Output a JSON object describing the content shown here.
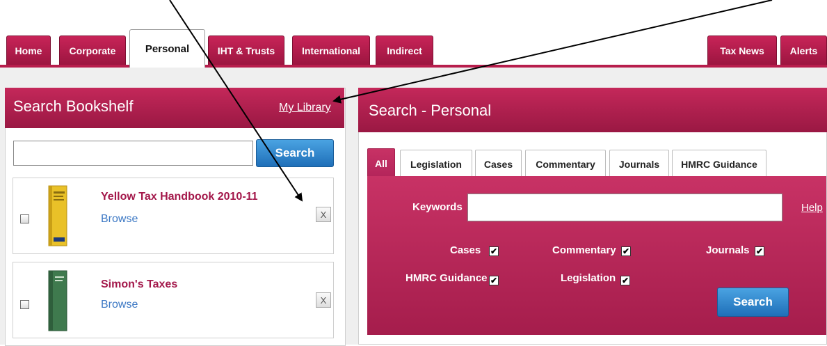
{
  "tabs_left": [
    {
      "label": "Home"
    },
    {
      "label": "Corporate"
    },
    {
      "label": "Personal",
      "active": true
    },
    {
      "label": "IHT & Trusts"
    },
    {
      "label": "International"
    },
    {
      "label": "Indirect"
    }
  ],
  "tabs_right": [
    {
      "label": "Tax News"
    },
    {
      "label": "Alerts"
    }
  ],
  "bookshelf": {
    "title": "Search Bookshelf",
    "my_library_link": "My Library",
    "search_input_value": "",
    "search_button": "Search",
    "books": [
      {
        "title": "Yellow Tax Handbook 2010-11",
        "browse_label": "Browse",
        "remove_label": "X",
        "checked": false,
        "cover_color": "#e9c128"
      },
      {
        "title": "Simon's Taxes",
        "browse_label": "Browse",
        "remove_label": "X",
        "checked": false,
        "cover_color": "#3f7a4e"
      }
    ]
  },
  "search_panel": {
    "title": "Search - Personal",
    "tabs": [
      "All",
      "Legislation",
      "Cases",
      "Commentary",
      "Journals",
      "HMRC Guidance"
    ],
    "active_tab": "All",
    "keywords_label": "Keywords",
    "keywords_value": "",
    "help_link": "Help",
    "filters": [
      {
        "label": "Cases",
        "checked": true
      },
      {
        "label": "Commentary",
        "checked": true
      },
      {
        "label": "Journals",
        "checked": true
      },
      {
        "label": "HMRC Guidance",
        "checked": true
      },
      {
        "label": "Legislation",
        "checked": true
      }
    ],
    "search_button": "Search"
  },
  "colors": {
    "brand": "#b71d4c",
    "button_blue": "#1f6fb8",
    "link_blue": "#3c78c4"
  }
}
